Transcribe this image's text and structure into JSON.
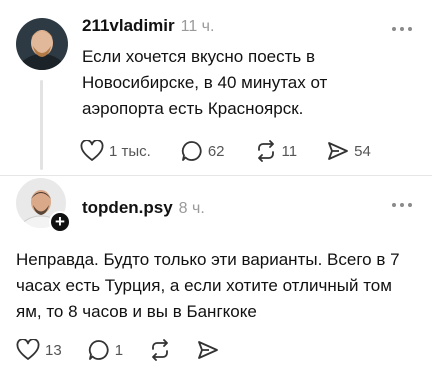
{
  "posts": [
    {
      "username": "211vladimir",
      "time": "11 ч.",
      "text": "Если хочется вкусно поесть в Новосибирске, в 40 минутах от аэропорта есть Красноярск.",
      "stats": {
        "likes": "1 тыс.",
        "comments": "62",
        "reposts": "11",
        "shares": "54"
      }
    },
    {
      "username": "topden.psy",
      "time": "8 ч.",
      "text": "Неправда. Будто только эти варианты. Всего в 7 часах есть Турция, а если хотите отличный том ям, то 8 часов и вы в Бангкоке",
      "stats": {
        "likes": "13",
        "comments": "1",
        "reposts": "",
        "shares": ""
      }
    }
  ],
  "icons": {
    "like": "heart-icon",
    "comment": "comment-icon",
    "repost": "repost-icon",
    "share": "share-icon",
    "more": "more-dots-icon",
    "follow": "plus-icon"
  }
}
